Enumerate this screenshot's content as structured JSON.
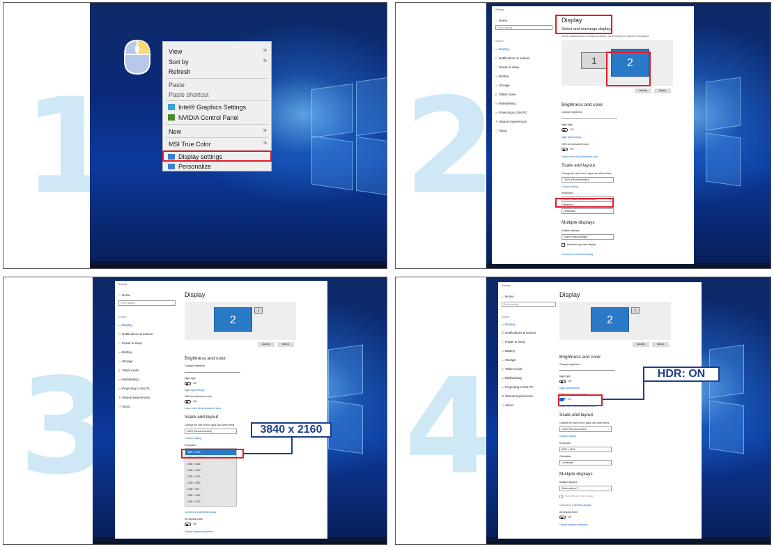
{
  "steps": [
    "1",
    "2",
    "3",
    "4"
  ],
  "context_menu": {
    "items": [
      {
        "label": "View",
        "submenu": true
      },
      {
        "label": "Sort by",
        "submenu": true
      },
      {
        "label": "Refresh",
        "submenu": false
      },
      {
        "label": "Paste",
        "submenu": false
      },
      {
        "label": "Paste shortcut",
        "submenu": false
      },
      {
        "label": "Intel® Graphics Settings",
        "submenu": false
      },
      {
        "label": "NVIDIA Control Panel",
        "submenu": false
      },
      {
        "label": "New",
        "submenu": true
      },
      {
        "label": "MSI True Color",
        "submenu": true
      },
      {
        "label": "Display settings",
        "submenu": false
      },
      {
        "label": "Personalize",
        "submenu": false
      }
    ],
    "arrow": ">"
  },
  "settings": {
    "window_title": "Settings",
    "home": "Home",
    "search_placeholder": "Find a setting",
    "section": "System",
    "nav": [
      "Display",
      "Notifications & actions",
      "Power & sleep",
      "Battery",
      "Storage",
      "Tablet mode",
      "Multitasking",
      "Projecting to this PC",
      "Shared experiences",
      "About"
    ],
    "title": "Display",
    "rearrange": "Select and rearrange displays",
    "rearrange_desc": "Select a display below to change its settings. Some settings are applied to all displays.",
    "monitor1": "1",
    "monitor2": "2",
    "identify": "Identify",
    "detect": "Detect",
    "brightness_header": "Brightness and color",
    "change_brightness": "Change brightness",
    "night_light": "Night light",
    "off": "Off",
    "on": "On",
    "night_light_settings": "Night light settings",
    "hdr": "HDR and advanced color",
    "learn_hdr": "Learn more about advanced color",
    "scale_header": "Scale and layout",
    "change_size": "Change the size of text, apps, and other items",
    "scale_value": "100% (Recommended)",
    "custom_scaling": "Custom scaling",
    "resolution": "Resolution",
    "resolution_value_p2": "2560 × 1440 (Recommended)",
    "resolution_value": "3840 × 2160",
    "resolution_options": [
      "3840 × 2160",
      "2560 × 1440 (Recommended)",
      "2048 × 1536",
      "1920 × 1440",
      "1920 × 1200",
      "1920 × 1080",
      "1768 × 992",
      "1680 × 1050",
      "1600 × 1200"
    ],
    "orientation": "Orientation",
    "landscape": "Landscape",
    "multiple_header": "Multiple displays",
    "multiple_label": "Multiple displays",
    "extend": "Extend these displays",
    "show_only": "Show only on 2",
    "make_main": "Make this my main display",
    "connect_wireless": "Connect to a wireless display",
    "display_3d": "3D display mode",
    "adapter": "Display adapter properties"
  },
  "callouts": {
    "resolution": "3840 x 2160",
    "hdr": "HDR: ON"
  },
  "colors": {
    "highlight_red": "#e01d26",
    "callout_blue": "#1a3e8c",
    "step_number": "#cfe8f5",
    "monitor_blue": "#2a79c7"
  }
}
